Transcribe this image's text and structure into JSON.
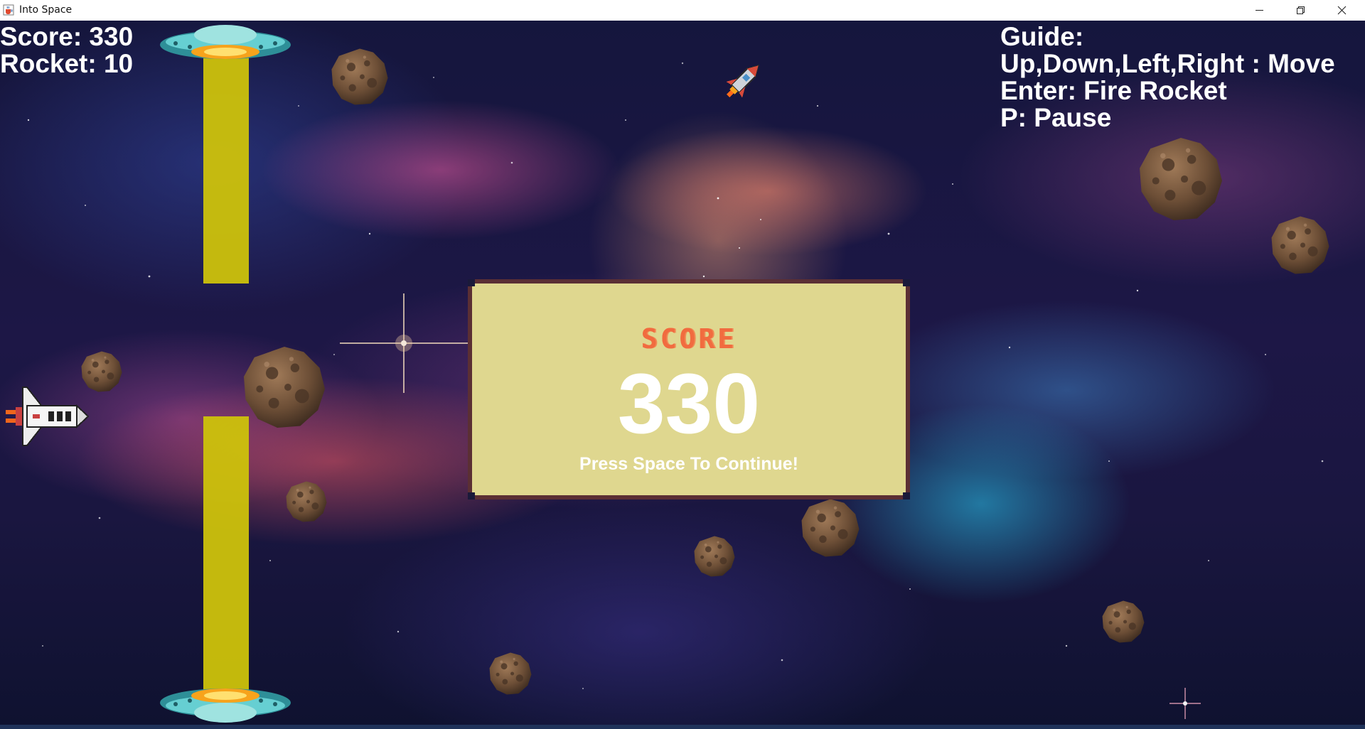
{
  "window": {
    "title": "Into Space",
    "icon": "java-cup-icon",
    "controls": [
      "minimize-icon",
      "maximize-icon",
      "close-icon"
    ]
  },
  "hud": {
    "score_label": "Score: 330",
    "rocket_label": "Rocket: 10"
  },
  "guide": {
    "title": "Guide:",
    "lines": [
      "Up,Down,Left,Right : Move",
      "Enter: Fire Rocket",
      "P: Pause"
    ]
  },
  "score_panel": {
    "label": "SCORE",
    "value": "330",
    "hint": "Press Space To Continue!"
  },
  "colors": {
    "beam": "#cdc20b",
    "panel_fill": "#dfd78f",
    "panel_border": "#5b2f34",
    "score_label": "#f16b3f",
    "hud_text": "#ffffff"
  },
  "sprites": [
    "ufo-icon",
    "ufo-icon",
    "space-shuttle-icon",
    "rocket-icon",
    "asteroid-icon"
  ]
}
